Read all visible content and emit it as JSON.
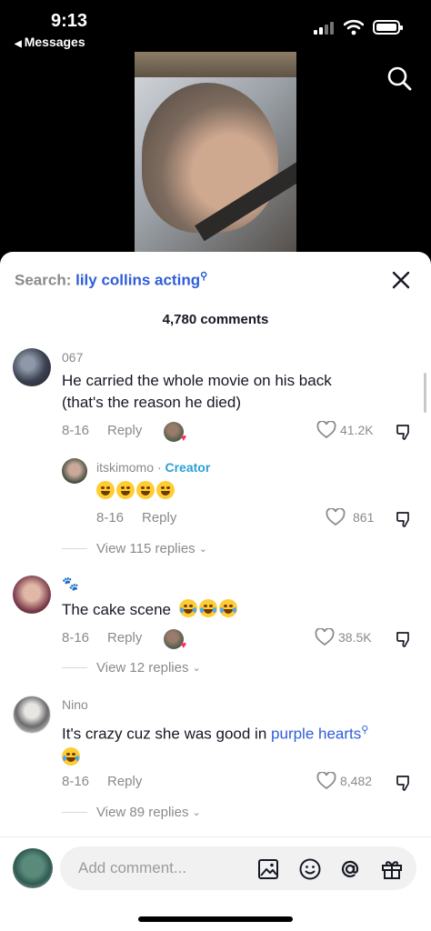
{
  "status_bar": {
    "time": "9:13",
    "back_label": "Messages"
  },
  "search": {
    "prefix": "Search:",
    "query": "lily collins acting"
  },
  "comment_count": "4,780 comments",
  "comments": [
    {
      "username": "067",
      "text_line1": "He carried the whole movie on his back",
      "text_line2": "(that's the reason he died)",
      "date": "8-16",
      "reply": "Reply",
      "likes": "41.2K"
    },
    {
      "username": "Nino",
      "text": "It's crazy cuz she was good in",
      "link": "purple hearts",
      "date": "8-16",
      "reply": "Reply",
      "likes": "8,482"
    }
  ],
  "creator_reply": {
    "username": "itskimomo",
    "tag": "Creator",
    "date": "8-16",
    "reply": "Reply",
    "likes": "861"
  },
  "view_replies": [
    "View 115 replies",
    "View 12 replies",
    "View 89 replies"
  ],
  "comment2": {
    "text": "The cake scene",
    "date": "8-16",
    "reply": "Reply",
    "likes": "38.5K"
  },
  "input": {
    "placeholder": "Add comment..."
  },
  "colors": {
    "link_blue": "#2e5dd9",
    "creator_blue": "#2a9fd6",
    "muted": "#8a8a8a"
  }
}
